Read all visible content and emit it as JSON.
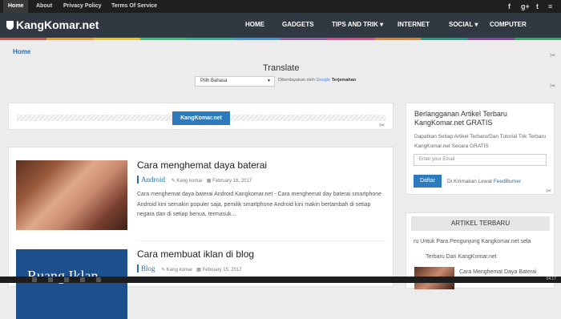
{
  "topbar": {
    "links": [
      "Home",
      "About",
      "Privacy Policy",
      "Terms Of Service"
    ],
    "social_icons": [
      "facebook-icon",
      "google-plus-icon",
      "twitter-icon",
      "rss-icon"
    ],
    "social_glyphs": [
      "f",
      "g+",
      "t",
      "≡"
    ]
  },
  "header": {
    "logo": "KangKomar.net",
    "nav": [
      "HOME",
      "GADGETS",
      "TIPS AND TRIK",
      "INTERNET",
      "SOCIAL",
      "COMPUTER"
    ],
    "dropdown_arrow": "▾",
    "strip_colors": [
      "#e74c3c",
      "#f39c12",
      "#f1c40f",
      "#2ecc71",
      "#1abc9c",
      "#3498db",
      "#9b59b6",
      "#e84393",
      "#e67e22",
      "#16a085",
      "#8e44ad",
      "#27ae60"
    ]
  },
  "breadcrumb": "Home",
  "translate": {
    "title": "Translate",
    "select_value": "Pilih Bahasa",
    "powered_prefix": "Diberdayakan oleh",
    "google": "Google",
    "terjemahan": "Terjemahan"
  },
  "tag_label": "KangKomar.net",
  "posts": [
    {
      "title": "Cara menghemat daya baterai",
      "category": "Android",
      "author": "Kang komar",
      "date": "February 16, 2017",
      "excerpt": "Cara menghemat daya baterai Android Kangkomar.net - Cara menghemat day baterai smartphone Android kini semakin populer saja, pemilik smartphone Android kini makin bertambah di setiap negara dan di setiap benua, termasuk..."
    },
    {
      "title": "Cara membuat iklan di blog",
      "category": "Blog",
      "author": "Kang komar",
      "date": "February 15, 2017",
      "thumb_text": "Ruang Iklan"
    }
  ],
  "sidebar": {
    "subscribe": {
      "title": "Berlangganan Artikel Terbaru KangKomar.net GRATIS",
      "description": "Dapatkan Setiap Artikel Terbaru/Dan Tutorial Trik Terbaru KangKomar.net Secara GRATIS",
      "email_placeholder": "Enter your Email",
      "button": "Daftar",
      "fb_prefix": "Di Kirimakan Lewat",
      "fb_link": "FeedBurner"
    },
    "latest": {
      "title": "ARTIKEL TERBARU",
      "marquee": "ru Untuk Para Pengunjung Kangkomar.net sela",
      "marquee2": "Terbaru Dari KangKomar.net",
      "item": "Cara Menghemat Daya Baterai"
    }
  },
  "taskbar": {
    "clock": "04.17"
  }
}
